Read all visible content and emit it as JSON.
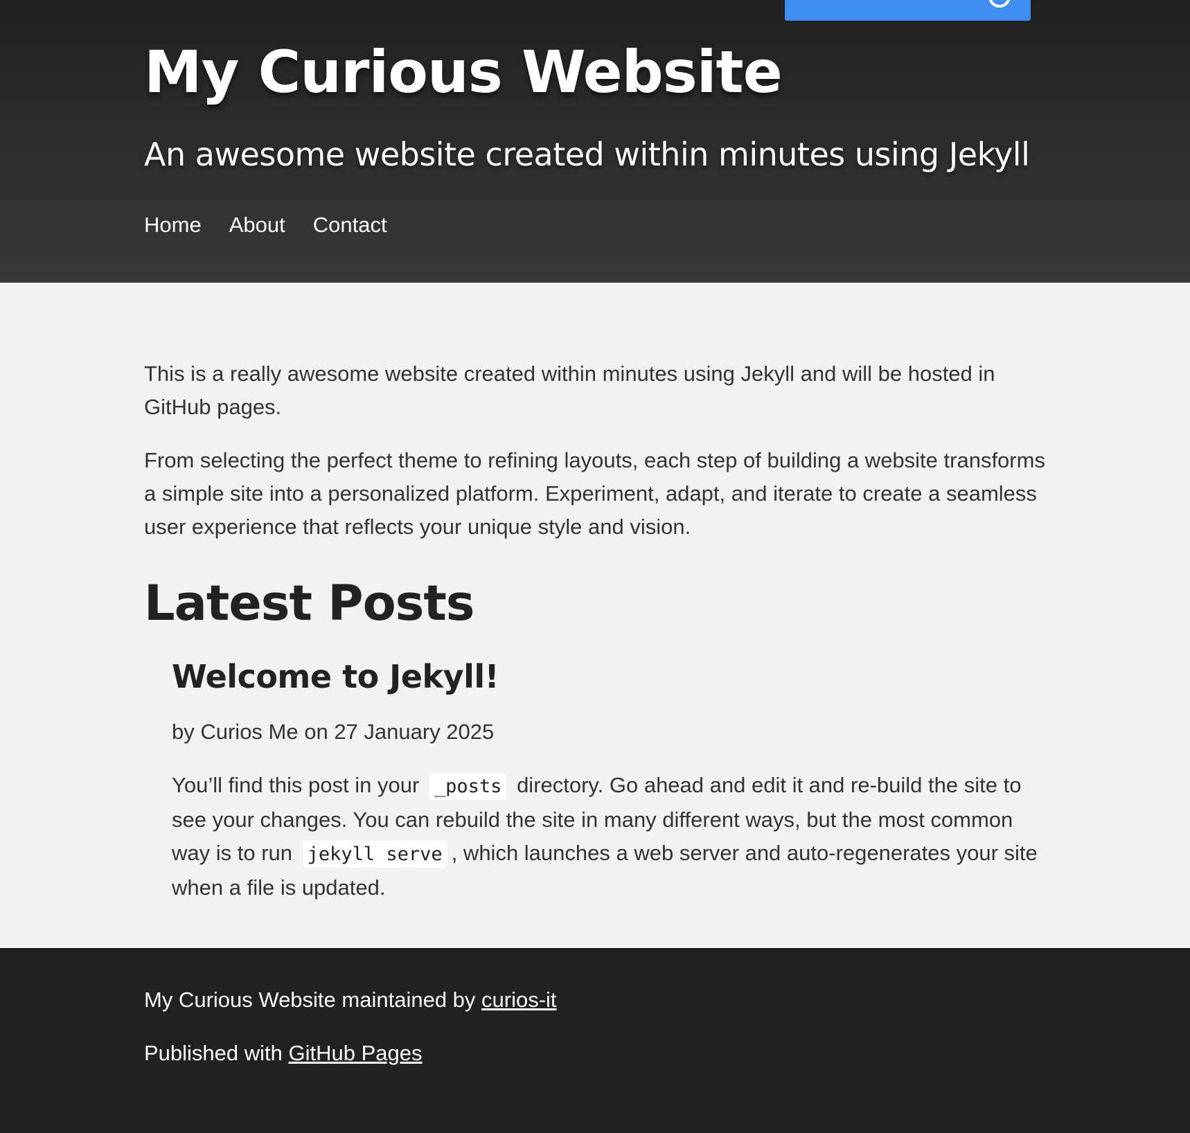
{
  "header": {
    "title": "My Curious Website",
    "tagline": "An awesome website created within minutes using Jekyll",
    "nav": [
      {
        "label": "Home"
      },
      {
        "label": "About"
      },
      {
        "label": "Contact"
      }
    ]
  },
  "intro": {
    "paragraph_1": "This is a really awesome website created within minutes using Jekyll and will be hosted in GitHub pages.",
    "paragraph_2": "From selecting the perfect theme to refining layouts, each step of building a website transforms a simple site into a personalized platform. Experiment, adapt, and iterate to create a seamless user experience that reflects your unique style and vision."
  },
  "posts": {
    "heading": "Latest Posts",
    "items": [
      {
        "title": "Welcome to Jekyll!",
        "meta": "by Curios Me on 27 January 2025",
        "body_part_1": "You’ll find this post in your ",
        "code_1": "_posts",
        "body_part_2": " directory. Go ahead and edit it and re-build the site to see your changes. You can rebuild the site in many different ways, but the most common way is to run ",
        "code_2": "jekyll serve",
        "body_part_3": ", which launches a web server and auto-regenerates your site when a file is updated."
      }
    ]
  },
  "footer": {
    "maintained_prefix": "My Curious Website maintained by ",
    "maintainer_link": "curios-it",
    "published_prefix": "Published with ",
    "published_link": "GitHub Pages"
  },
  "icons": {
    "github_badge": "github-icon"
  },
  "colors": {
    "header_top": "#212121",
    "header_bottom": "#383838",
    "body_background": "#f2f2f2",
    "footer_background": "#212121",
    "github_button": "#3e8ef1"
  }
}
